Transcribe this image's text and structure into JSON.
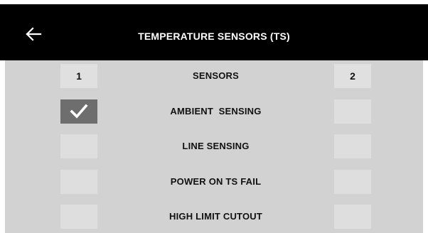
{
  "header": {
    "title": "TEMPERATURE SENSORS (TS)",
    "back_icon": "arrow-left-icon"
  },
  "columns": {
    "left_label": "1",
    "center_label": "SENSORS",
    "right_label": "2"
  },
  "rows": [
    {
      "label": "AMBIENT  SENSING",
      "sensor1_checked": true,
      "sensor2_checked": false
    },
    {
      "label": "LINE SENSING",
      "sensor1_checked": false,
      "sensor2_checked": false
    },
    {
      "label": "POWER ON TS FAIL",
      "sensor1_checked": false,
      "sensor2_checked": false
    },
    {
      "label": "HIGH LIMIT CUTOUT",
      "sensor1_checked": false,
      "sensor2_checked": false
    }
  ],
  "colors": {
    "header_bg": "#000000",
    "panel_bg": "#d2d2d2",
    "checkbox_bg": "#dedede",
    "checkbox_checked_bg": "#6e6e6e",
    "check_mark": "#ffffff"
  }
}
